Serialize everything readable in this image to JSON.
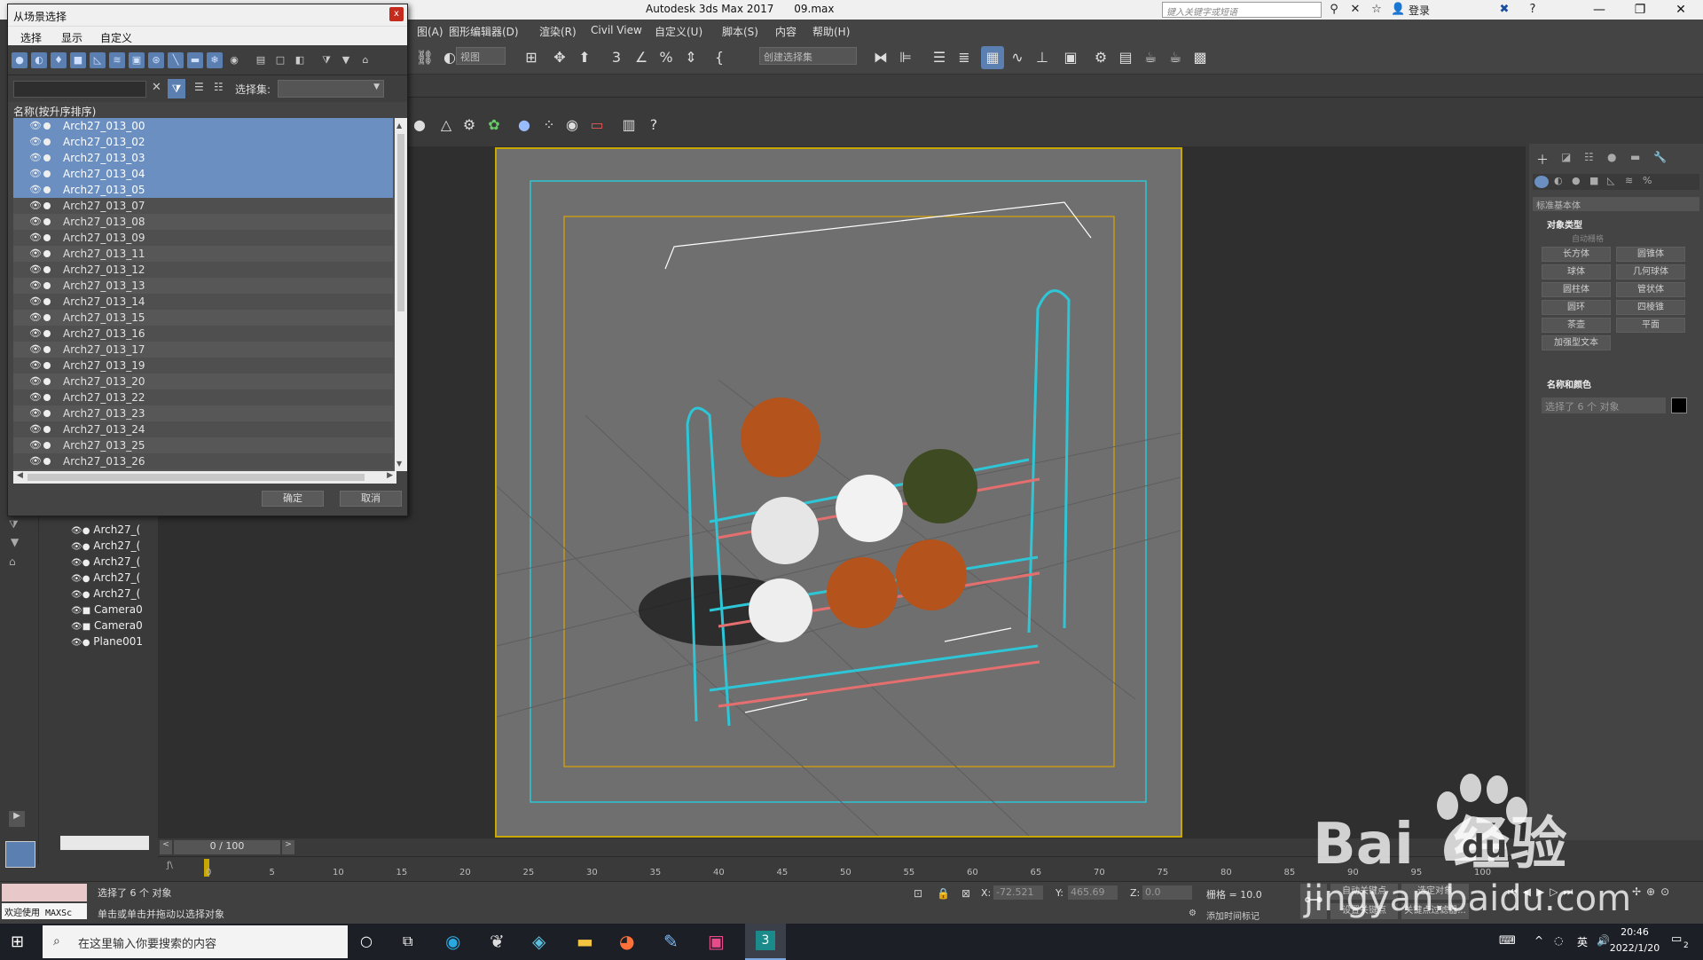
{
  "window": {
    "app_title": "Autodesk 3ds Max 2017",
    "file_name": "09.max",
    "search_placeholder": "键入关键字或短语",
    "login": "登录"
  },
  "menubar": {
    "items": [
      "图(A)",
      "图形编辑器(D)",
      "渲染(R)",
      "Civil View",
      "自定义(U)",
      "脚本(S)",
      "内容",
      "帮助(H)"
    ]
  },
  "toolbar": {
    "view_dropdown": "视图",
    "selection_set_dropdown": "创建选择集"
  },
  "dialog": {
    "title": "从场景选择",
    "close": "x",
    "menu": [
      "选择",
      "显示",
      "自定义"
    ],
    "selection_set_label": "选择集:",
    "list_header": "名称(按升序排序)",
    "items": [
      {
        "name": "Arch27_013_00",
        "selected": true
      },
      {
        "name": "Arch27_013_02",
        "selected": true
      },
      {
        "name": "Arch27_013_03",
        "selected": true
      },
      {
        "name": "Arch27_013_04",
        "selected": true
      },
      {
        "name": "Arch27_013_05",
        "selected": true
      },
      {
        "name": "Arch27_013_07",
        "selected": false
      },
      {
        "name": "Arch27_013_08",
        "selected": false
      },
      {
        "name": "Arch27_013_09",
        "selected": false
      },
      {
        "name": "Arch27_013_11",
        "selected": false
      },
      {
        "name": "Arch27_013_12",
        "selected": false
      },
      {
        "name": "Arch27_013_13",
        "selected": false
      },
      {
        "name": "Arch27_013_14",
        "selected": false
      },
      {
        "name": "Arch27_013_15",
        "selected": false
      },
      {
        "name": "Arch27_013_16",
        "selected": false
      },
      {
        "name": "Arch27_013_17",
        "selected": false
      },
      {
        "name": "Arch27_013_19",
        "selected": false
      },
      {
        "name": "Arch27_013_20",
        "selected": false
      },
      {
        "name": "Arch27_013_22",
        "selected": false
      },
      {
        "name": "Arch27_013_23",
        "selected": false
      },
      {
        "name": "Arch27_013_24",
        "selected": false
      },
      {
        "name": "Arch27_013_25",
        "selected": false
      },
      {
        "name": "Arch27_013_26",
        "selected": false
      }
    ],
    "ok_label": "确定",
    "cancel_label": "取消"
  },
  "scene_explorer": {
    "items": [
      "Arch27_(",
      "Arch27_(",
      "Arch27_(",
      "Arch27_(",
      "Arch27_(",
      "Camera0",
      "Camera0",
      "Plane001"
    ]
  },
  "command_panel": {
    "category_dropdown": "标准基本体",
    "object_type_title": "对象类型",
    "autogrid_label": "自动栅格",
    "buttons": [
      "长方体",
      "圆锥体",
      "球体",
      "几何球体",
      "圆柱体",
      "管状体",
      "圆环",
      "四棱锥",
      "茶壶",
      "平面",
      "加强型文本"
    ],
    "name_color_title": "名称和颜色",
    "name_field": "选择了 6 个 对象"
  },
  "timeline": {
    "frame_display": "0 / 100",
    "ticks": [
      "0",
      "5",
      "10",
      "15",
      "20",
      "25",
      "30",
      "35",
      "40",
      "45",
      "50",
      "55",
      "60",
      "65",
      "70",
      "75",
      "80",
      "85",
      "90",
      "95",
      "100"
    ]
  },
  "statusbar": {
    "maxscript_label": "欢迎使用 MAXSc",
    "status_line1": "选择了 6 个 对象",
    "status_line2": "单击或单击并拖动以选择对象",
    "x_label": "X:",
    "x_value": "-72.521",
    "y_label": "Y:",
    "y_value": "465.69",
    "z_label": "Z:",
    "z_value": "0.0",
    "grid": "栅格 = 10.0",
    "add_time_tag": "添加时间标记",
    "auto_key": "自动关键点",
    "selected_objects": "选定对象",
    "set_key": "设置关键点",
    "key_filters": "关键点过滤器..."
  },
  "taskbar": {
    "search_placeholder": "在这里输入你要搜索的内容",
    "time": "20:46",
    "date": "2022/1/20",
    "ime": "英",
    "notifications": "2"
  },
  "watermark": {
    "brand": "Bai  经验",
    "url": "jingyan.baidu.com"
  }
}
